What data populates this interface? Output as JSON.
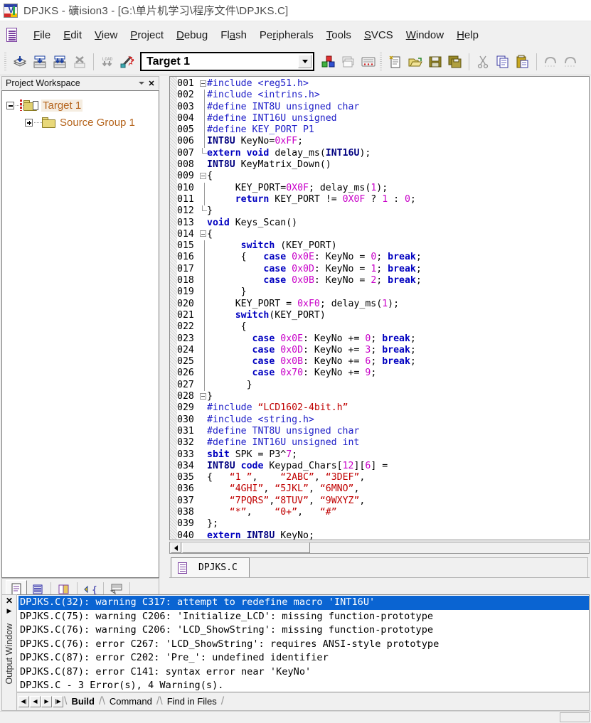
{
  "window": {
    "icon": "uvision-app-icon",
    "title": "DPJKS  - 礦ision3 - [G:\\单片机学习\\程序文件\\DPJKS.C]"
  },
  "menubar": {
    "doc_icon": "document-icon",
    "items": [
      {
        "label": "File",
        "mnemonic_index": 0
      },
      {
        "label": "Edit",
        "mnemonic_index": 0
      },
      {
        "label": "View",
        "mnemonic_index": 0
      },
      {
        "label": "Project",
        "mnemonic_index": 0
      },
      {
        "label": "Debug",
        "mnemonic_index": 0
      },
      {
        "label": "Flash",
        "mnemonic_index": 2
      },
      {
        "label": "Peripherals",
        "mnemonic_index": 2
      },
      {
        "label": "Tools",
        "mnemonic_index": 0
      },
      {
        "label": "SVCS",
        "mnemonic_index": 0
      },
      {
        "label": "Window",
        "mnemonic_index": 0
      },
      {
        "label": "Help",
        "mnemonic_index": 0
      }
    ]
  },
  "toolbar": {
    "groups": [
      [
        "translate-icon",
        "build-target-icon",
        "rebuild-all-icon",
        "stop-build-icon"
      ],
      [
        "download-to-flash-icon",
        "start-stop-debug-icon"
      ]
    ],
    "target_combo": {
      "value": "Target 1",
      "dropdown_icon": "chevron-down-icon"
    },
    "groups_after": [
      [
        "target-options-icon",
        "manage-components-icon",
        "keyboard-icon"
      ],
      [
        "new-file-icon",
        "open-file-icon",
        "save-icon",
        "save-all-icon"
      ],
      [
        "cut-icon",
        "copy-icon",
        "paste-icon"
      ],
      [
        "undo-icon",
        "redo-icon"
      ]
    ]
  },
  "workspace": {
    "title": "Project Workspace",
    "dropdown_icon": "chevron-down-icon",
    "close_icon": "close-icon",
    "tree": [
      {
        "label": "Target 1",
        "icon": "target-folder-icon",
        "expander": "minus",
        "selected": true,
        "level": 0
      },
      {
        "label": "Source Group 1",
        "icon": "folder-icon",
        "expander": "plus",
        "selected": false,
        "level": 1
      }
    ],
    "tabs": [
      {
        "icon": "files-page-icon",
        "name": "files-tab",
        "active": true
      },
      {
        "icon": "regs-list-icon",
        "name": "regs-tab",
        "active": false
      },
      {
        "icon": "books-icon",
        "name": "books-tab",
        "active": false
      },
      {
        "icon": "functions-icon",
        "name": "functions-tab",
        "active": false
      },
      {
        "icon": "templates-icon",
        "name": "templates-tab",
        "active": false
      }
    ]
  },
  "editor": {
    "tab": {
      "label": "DPJKS.C",
      "icon": "document-icon"
    },
    "scrollbar": {
      "left_arrow_icon": "arrow-left-icon"
    },
    "lines": [
      {
        "n": "001",
        "fold": "open",
        "text": "#include <reg51.h>"
      },
      {
        "n": "002",
        "fold": "bar",
        "text": "#include <intrins.h>"
      },
      {
        "n": "003",
        "fold": "bar",
        "text": "#define INT8U unsigned char"
      },
      {
        "n": "004",
        "fold": "bar",
        "text": "#define INT16U unsigned"
      },
      {
        "n": "005",
        "fold": "bar",
        "text": "#define KEY_PORT P1"
      },
      {
        "n": "006",
        "fold": "bar",
        "text": "INT8U KeyNo=0xFF;"
      },
      {
        "n": "007",
        "fold": "end",
        "text": "extern void delay_ms(INT16U);"
      },
      {
        "n": "008",
        "fold": "none",
        "text": "INT8U KeyMatrix_Down()"
      },
      {
        "n": "009",
        "fold": "open",
        "text": "{"
      },
      {
        "n": "010",
        "fold": "bar",
        "text": "     KEY_PORT=0X0F; delay_ms(1);"
      },
      {
        "n": "011",
        "fold": "bar",
        "text": "     return KEY_PORT != 0X0F ? 1 : 0;"
      },
      {
        "n": "012",
        "fold": "end",
        "text": "}"
      },
      {
        "n": "013",
        "fold": "none",
        "text": "void Keys_Scan()"
      },
      {
        "n": "014",
        "fold": "open",
        "text": "{"
      },
      {
        "n": "015",
        "fold": "bar",
        "text": "      switch (KEY_PORT)"
      },
      {
        "n": "016",
        "fold": "bar",
        "text": "      {   case 0x0E: KeyNo = 0; break;"
      },
      {
        "n": "017",
        "fold": "bar",
        "text": "          case 0x0D: KeyNo = 1; break;"
      },
      {
        "n": "018",
        "fold": "bar",
        "text": "          case 0x0B: KeyNo = 2; break;"
      },
      {
        "n": "019",
        "fold": "bar",
        "text": "      }"
      },
      {
        "n": "020",
        "fold": "bar",
        "text": "     KEY_PORT = 0xF0; delay_ms(1);"
      },
      {
        "n": "021",
        "fold": "bar",
        "text": "     switch(KEY_PORT)"
      },
      {
        "n": "022",
        "fold": "bar",
        "text": "      {"
      },
      {
        "n": "023",
        "fold": "bar",
        "text": "        case 0x0E: KeyNo += 0; break;"
      },
      {
        "n": "024",
        "fold": "bar",
        "text": "        case 0x0D: KeyNo += 3; break;"
      },
      {
        "n": "025",
        "fold": "bar",
        "text": "        case 0x0B: KeyNo += 6; break;"
      },
      {
        "n": "026",
        "fold": "bar",
        "text": "        case 0x70: KeyNo += 9;"
      },
      {
        "n": "027",
        "fold": "bar",
        "text": "       }"
      },
      {
        "n": "028",
        "fold": "open",
        "text": "}"
      },
      {
        "n": "029",
        "fold": "none",
        "text": "#include “LCD1602-4bit.h”"
      },
      {
        "n": "030",
        "fold": "none",
        "text": "#include <string.h>"
      },
      {
        "n": "031",
        "fold": "none",
        "text": "#define TNT8U unsigned char"
      },
      {
        "n": "032",
        "fold": "none",
        "text": "#define INT16U unsigned int"
      },
      {
        "n": "033",
        "fold": "none",
        "text": "sbit SPK = P3^7;"
      },
      {
        "n": "034",
        "fold": "none",
        "text": "INT8U code Keypad_Chars[12][6] ="
      },
      {
        "n": "035",
        "fold": "none",
        "text": "{   “1 ”,    “2ABC”, “3DEF”,"
      },
      {
        "n": "036",
        "fold": "none",
        "text": "    “4GHI”, “5JKL”, “6MNO”,"
      },
      {
        "n": "037",
        "fold": "none",
        "text": "    “7PQRS”,“8TUV”, “9WXYZ”,"
      },
      {
        "n": "038",
        "fold": "none",
        "text": "    “*”,    “0+”,   “#”"
      },
      {
        "n": "039",
        "fold": "none",
        "text": "};"
      },
      {
        "n": "040",
        "fold": "none",
        "text": "extern INT8U KeyNo;"
      }
    ]
  },
  "output_window": {
    "side_label": "Output Window",
    "close_icon": "close-icon",
    "expand_icon": "triangle-right-icon",
    "lines": [
      {
        "text": "DPJKS.C(32): warning C317: attempt to redefine macro 'INT16U'",
        "selected": true
      },
      {
        "text": "DPJKS.C(75): warning C206: 'Initialize_LCD': missing function-prototype",
        "selected": false
      },
      {
        "text": "DPJKS.C(76): warning C206: 'LCD_ShowString': missing function-prototype",
        "selected": false
      },
      {
        "text": "DPJKS.C(76): error C267: 'LCD_ShowString': requires ANSI-style prototype",
        "selected": false
      },
      {
        "text": "DPJKS.C(87): error C202: 'Pre_': undefined identifier",
        "selected": false
      },
      {
        "text": "DPJKS.C(87): error C141: syntax error near 'KeyNo'",
        "selected": false
      },
      {
        "text": "DPJKS.C - 3 Error(s), 4 Warning(s).",
        "selected": false
      }
    ],
    "nav_buttons": [
      {
        "icon": "first-icon",
        "glyph": "|◀"
      },
      {
        "icon": "prev-icon",
        "glyph": "◀"
      },
      {
        "icon": "next-icon",
        "glyph": "▶"
      },
      {
        "icon": "last-icon",
        "glyph": "▶|"
      }
    ],
    "tabs": [
      {
        "label": "Build",
        "active": true
      },
      {
        "label": "Command",
        "active": false
      },
      {
        "label": "Find in Files",
        "active": false
      }
    ]
  },
  "colors": {
    "selection_blue": "#0a64d2",
    "keyword_blue": "#0000c0",
    "number_magenta": "#c800c8",
    "string_red": "#c00000",
    "tree_orange": "#b5651d",
    "chrome_gray": "#f0f0f0"
  }
}
